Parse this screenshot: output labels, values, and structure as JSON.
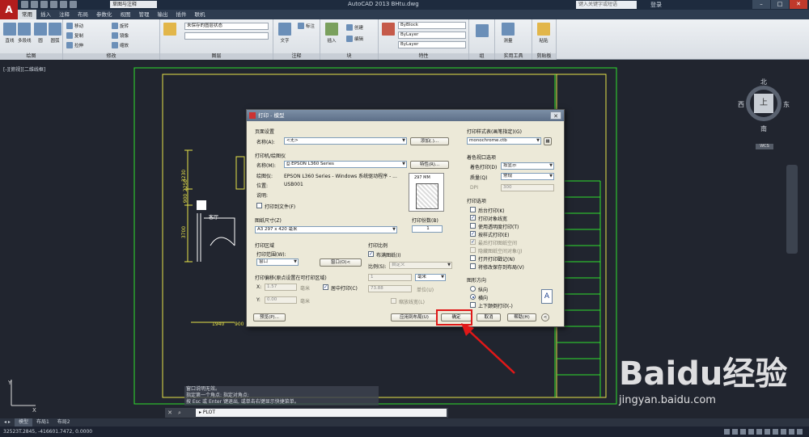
{
  "titlebar": {
    "workspace": "草图与注释",
    "title": "AutoCAD 2013    BHtu.dwg",
    "search_placeholder": "键入关键字或短语",
    "login": "登录"
  },
  "menu_tabs": [
    "常用",
    "插入",
    "注释",
    "布局",
    "参数化",
    "视图",
    "管理",
    "输出",
    "插件",
    "联机"
  ],
  "ribbon": {
    "panels": [
      "绘图",
      "修改",
      "图层",
      "注释",
      "块",
      "特性",
      "组",
      "实用工具",
      "剪贴板"
    ],
    "draw_tools": [
      "直线",
      "多段线",
      "圆",
      "圆弧"
    ],
    "modify_tools": [
      "移动",
      "旋转",
      "复制",
      "镜像",
      "拉伸",
      "缩放"
    ],
    "layer_state": "未保存的图层状态",
    "annot_tools": [
      "文字",
      "标注"
    ],
    "block_tools": [
      "插入",
      "创建",
      "编辑"
    ],
    "bylayer": "ByLayer",
    "byblock": "ByBlock",
    "util_tools": [
      "测量",
      "粘贴"
    ]
  },
  "viewport": {
    "label": "[-][俯视][二维线框]"
  },
  "drawing_text": {
    "dim1": "3230",
    "dim2": "2250",
    "dim3": "900",
    "dim4": "3700",
    "room": "客厅",
    "dim5": "1940",
    "dim6": "900"
  },
  "viewcube": {
    "north": "北",
    "south": "南",
    "east": "东",
    "west": "西",
    "top": "上",
    "wcs": "WCS"
  },
  "dialog": {
    "title": "打印 - 模型",
    "page_setup": "页面设置",
    "name_label": "名称(A):",
    "name_value": "<无>",
    "add_button": "添加(.)...",
    "printer_section": "打印机/绘图仪",
    "printer_name_label": "名称(M):",
    "printer_value": "EPSON L360 Series",
    "properties_button": "特性(R)...",
    "plotter_label": "绘图仪:",
    "plotter_value": "EPSON L360 Series - Windows 系统驱动程序 - ...",
    "location_label": "位置:",
    "location_value": "USB001",
    "desc_label": "说明:",
    "print_to_file": "打印到文件(F)",
    "preview_dim": "297 MM",
    "paper_size_label": "图纸尺寸(Z)",
    "paper_size_value": "A3 297 x 420 毫米",
    "copies_label": "打印份数(B)",
    "copies_value": "1",
    "plot_area": "打印区域",
    "plot_range_label": "打印范围(W):",
    "plot_range_value": "窗口",
    "window_button": "窗口(O)<",
    "plot_scale": "打印比例",
    "fit_paper": "布满图纸(I)",
    "scale_label": "比例(S):",
    "scale_value": "自定义",
    "scale_1": "1",
    "scale_unit": "毫米",
    "scale_2": "73.88",
    "unit_label": "单位(U)",
    "scale_lineweights": "缩放线宽(L)",
    "offset_section": "打印偏移(原点设置在可打印区域)",
    "x_label": "X:",
    "x_value": "1.57",
    "y_label": "Y:",
    "y_value": "0.00",
    "mm": "毫米",
    "center_plot": "居中打印(C)",
    "preview_button": "预览(P)...",
    "apply_layout_button": "应用到布局(U)",
    "ok_button": "确定",
    "cancel_button": "取消",
    "help_button": "帮助(H)",
    "more_button": "<",
    "style_table_label": "打印样式表(画笔指定)(G)",
    "style_table_value": "monochrome.ctb",
    "shaded_section": "着色视口选项",
    "shade_label": "着色打印(D)",
    "shade_value": "按显示",
    "quality_label": "质量(Q)",
    "quality_value": "常规",
    "dpi_label": "DPI",
    "dpi_value": "300",
    "options_section": "打印选项",
    "options": [
      {
        "label": "后台打印(K)",
        "checked": false,
        "enabled": true
      },
      {
        "label": "打印对象线宽",
        "checked": true,
        "enabled": true
      },
      {
        "label": "使用透明度打印(T)",
        "checked": false,
        "enabled": true
      },
      {
        "label": "按样式打印(E)",
        "checked": true,
        "enabled": true
      },
      {
        "label": "最后打印图纸空间",
        "checked": true,
        "enabled": false
      },
      {
        "label": "隐藏图纸空间对象(J)",
        "checked": false,
        "enabled": false
      },
      {
        "label": "打开打印戳记(N)",
        "checked": false,
        "enabled": true
      },
      {
        "label": "将修改保存到布局(V)",
        "checked": false,
        "enabled": true
      }
    ],
    "orientation_section": "图形方向",
    "portrait": "纵向",
    "landscape": "横向",
    "upside_down": "上下颠倒打印(-)",
    "orientation_selected": "landscape"
  },
  "command": {
    "history": [
      "窗口说明无效。",
      "指定第一个角点: 指定对角点:",
      "按 Esc 或 Enter 键退出, 或单击右键显示快捷菜单。"
    ],
    "input": "PLOT"
  },
  "layout_tabs": [
    "模型",
    "布局1",
    "布局2"
  ],
  "status": {
    "coords": "32523T.2845, -416601.7472, 0.0000"
  },
  "watermark": {
    "brand": "Baidu经验",
    "url": "jingyan.baidu.com"
  },
  "colors": {
    "drawing_bg": "#21252f",
    "cad_green": "#2ee02e",
    "cad_yellow": "#e8e34a",
    "highlight": "#e01818",
    "dialog_bg": "#ece9d8"
  }
}
